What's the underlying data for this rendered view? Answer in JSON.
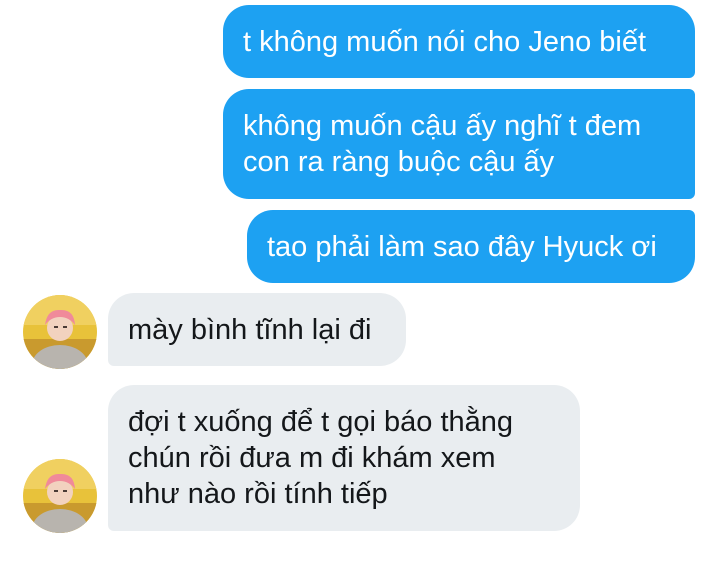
{
  "colors": {
    "sent_bubble": "#1da1f2",
    "sent_text": "#ffffff",
    "received_bubble": "#e9edf0",
    "received_text": "#14171a"
  },
  "messages": [
    {
      "direction": "sent",
      "text": "t không muốn nói cho Jeno biết"
    },
    {
      "direction": "sent",
      "text": "không muốn cậu ấy nghĩ t đem\ncon ra ràng buộc cậu ấy"
    },
    {
      "direction": "sent",
      "text": "tao phải làm sao đây Hyuck ơi"
    },
    {
      "direction": "received",
      "text": "mày bình tĩnh lại đi",
      "avatar": "contact-avatar"
    },
    {
      "direction": "received",
      "text": "đợi t xuống để t gọi báo thằng\nchún rồi đưa m đi khám xem\nnhư nào rồi tính tiếp",
      "avatar": "contact-avatar"
    }
  ]
}
